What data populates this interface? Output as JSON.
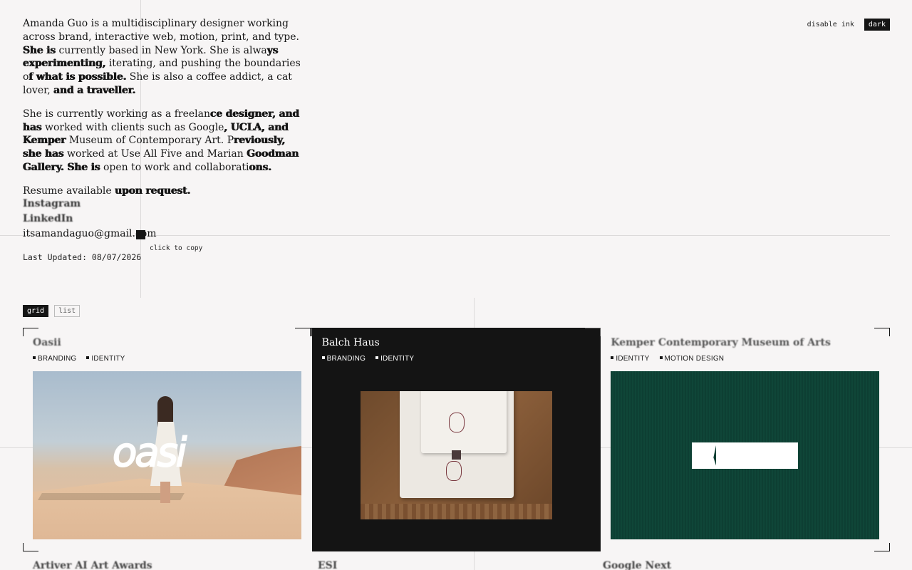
{
  "controls": {
    "disable_ink": "disable ink",
    "dark": "dark"
  },
  "bio": {
    "p1": {
      "plain1": "Amanda Guo is a multidisciplinary designer working across brand, interactive web, motion, print, and type. ",
      "bold1": "She is",
      "plain2": " currently based in New York. She is alwa",
      "bold2": "ys experimenting,",
      "plain3": " iterating, and pushing the boundaries o",
      "bold3": "f what is possible.",
      "plain4": " She is also a coffee addict, a cat lover, ",
      "bold4": "and a traveller."
    },
    "p2": {
      "plain1": "She is currently working as a freelan",
      "bold1": "ce designer, and has",
      "plain2": " worked with clients such as Google",
      "bold2": ", UCLA, and Kemper",
      "plain3": " Museum of Contemporary Art. P",
      "bold3": "reviously, she has",
      "plain4": " worked at Use All Five and Marian ",
      "bold4": "Goodman Gallery. She is",
      "plain5": " open to work and collaborati",
      "bold5": "ons."
    },
    "p3": {
      "plain": "Resume available ",
      "bold": "upon request."
    }
  },
  "links": {
    "instagram": "Instagram",
    "linkedin": "LinkedIn",
    "email": "itsamandaguo@gmail.com"
  },
  "copy_hint": "click to copy",
  "last_updated": "Last Updated: 08/07/2026",
  "view": {
    "grid": "grid",
    "list": "list",
    "active": "grid"
  },
  "projects": [
    {
      "title": "Oasii",
      "tags": [
        "BRANDING",
        "IDENTITY"
      ],
      "thumb_text": "oasi"
    },
    {
      "title": "Balch Haus",
      "tags": [
        "BRANDING",
        "IDENTITY"
      ]
    },
    {
      "title": "Kemper Contemporary Museum of Arts",
      "tags": [
        "IDENTITY",
        "MOTION DESIGN"
      ]
    }
  ],
  "next_projects": [
    "Artiver AI Art Awards",
    "ESI",
    "Google Next"
  ],
  "colors": {
    "background": "#f7f5f5",
    "ink": "#151515",
    "kemper_green": "#0d3f33",
    "card_dark": "#141414"
  }
}
